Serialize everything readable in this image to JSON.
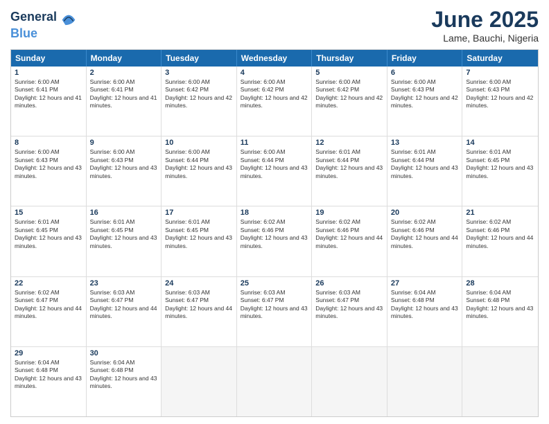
{
  "header": {
    "logo_general": "General",
    "logo_blue": "Blue",
    "month_title": "June 2025",
    "location": "Lame, Bauchi, Nigeria"
  },
  "calendar": {
    "days": [
      "Sunday",
      "Monday",
      "Tuesday",
      "Wednesday",
      "Thursday",
      "Friday",
      "Saturday"
    ],
    "rows": [
      [
        {
          "day": "1",
          "sunrise": "6:00 AM",
          "sunset": "6:41 PM",
          "daylight": "12 hours and 41 minutes."
        },
        {
          "day": "2",
          "sunrise": "6:00 AM",
          "sunset": "6:41 PM",
          "daylight": "12 hours and 41 minutes."
        },
        {
          "day": "3",
          "sunrise": "6:00 AM",
          "sunset": "6:42 PM",
          "daylight": "12 hours and 42 minutes."
        },
        {
          "day": "4",
          "sunrise": "6:00 AM",
          "sunset": "6:42 PM",
          "daylight": "12 hours and 42 minutes."
        },
        {
          "day": "5",
          "sunrise": "6:00 AM",
          "sunset": "6:42 PM",
          "daylight": "12 hours and 42 minutes."
        },
        {
          "day": "6",
          "sunrise": "6:00 AM",
          "sunset": "6:43 PM",
          "daylight": "12 hours and 42 minutes."
        },
        {
          "day": "7",
          "sunrise": "6:00 AM",
          "sunset": "6:43 PM",
          "daylight": "12 hours and 42 minutes."
        }
      ],
      [
        {
          "day": "8",
          "sunrise": "6:00 AM",
          "sunset": "6:43 PM",
          "daylight": "12 hours and 43 minutes."
        },
        {
          "day": "9",
          "sunrise": "6:00 AM",
          "sunset": "6:43 PM",
          "daylight": "12 hours and 43 minutes."
        },
        {
          "day": "10",
          "sunrise": "6:00 AM",
          "sunset": "6:44 PM",
          "daylight": "12 hours and 43 minutes."
        },
        {
          "day": "11",
          "sunrise": "6:00 AM",
          "sunset": "6:44 PM",
          "daylight": "12 hours and 43 minutes."
        },
        {
          "day": "12",
          "sunrise": "6:01 AM",
          "sunset": "6:44 PM",
          "daylight": "12 hours and 43 minutes."
        },
        {
          "day": "13",
          "sunrise": "6:01 AM",
          "sunset": "6:44 PM",
          "daylight": "12 hours and 43 minutes."
        },
        {
          "day": "14",
          "sunrise": "6:01 AM",
          "sunset": "6:45 PM",
          "daylight": "12 hours and 43 minutes."
        }
      ],
      [
        {
          "day": "15",
          "sunrise": "6:01 AM",
          "sunset": "6:45 PM",
          "daylight": "12 hours and 43 minutes."
        },
        {
          "day": "16",
          "sunrise": "6:01 AM",
          "sunset": "6:45 PM",
          "daylight": "12 hours and 43 minutes."
        },
        {
          "day": "17",
          "sunrise": "6:01 AM",
          "sunset": "6:45 PM",
          "daylight": "12 hours and 43 minutes."
        },
        {
          "day": "18",
          "sunrise": "6:02 AM",
          "sunset": "6:46 PM",
          "daylight": "12 hours and 43 minutes."
        },
        {
          "day": "19",
          "sunrise": "6:02 AM",
          "sunset": "6:46 PM",
          "daylight": "12 hours and 44 minutes."
        },
        {
          "day": "20",
          "sunrise": "6:02 AM",
          "sunset": "6:46 PM",
          "daylight": "12 hours and 44 minutes."
        },
        {
          "day": "21",
          "sunrise": "6:02 AM",
          "sunset": "6:46 PM",
          "daylight": "12 hours and 44 minutes."
        }
      ],
      [
        {
          "day": "22",
          "sunrise": "6:02 AM",
          "sunset": "6:47 PM",
          "daylight": "12 hours and 44 minutes."
        },
        {
          "day": "23",
          "sunrise": "6:03 AM",
          "sunset": "6:47 PM",
          "daylight": "12 hours and 44 minutes."
        },
        {
          "day": "24",
          "sunrise": "6:03 AM",
          "sunset": "6:47 PM",
          "daylight": "12 hours and 44 minutes."
        },
        {
          "day": "25",
          "sunrise": "6:03 AM",
          "sunset": "6:47 PM",
          "daylight": "12 hours and 43 minutes."
        },
        {
          "day": "26",
          "sunrise": "6:03 AM",
          "sunset": "6:47 PM",
          "daylight": "12 hours and 43 minutes."
        },
        {
          "day": "27",
          "sunrise": "6:04 AM",
          "sunset": "6:48 PM",
          "daylight": "12 hours and 43 minutes."
        },
        {
          "day": "28",
          "sunrise": "6:04 AM",
          "sunset": "6:48 PM",
          "daylight": "12 hours and 43 minutes."
        }
      ],
      [
        {
          "day": "29",
          "sunrise": "6:04 AM",
          "sunset": "6:48 PM",
          "daylight": "12 hours and 43 minutes."
        },
        {
          "day": "30",
          "sunrise": "6:04 AM",
          "sunset": "6:48 PM",
          "daylight": "12 hours and 43 minutes."
        },
        null,
        null,
        null,
        null,
        null
      ]
    ]
  }
}
